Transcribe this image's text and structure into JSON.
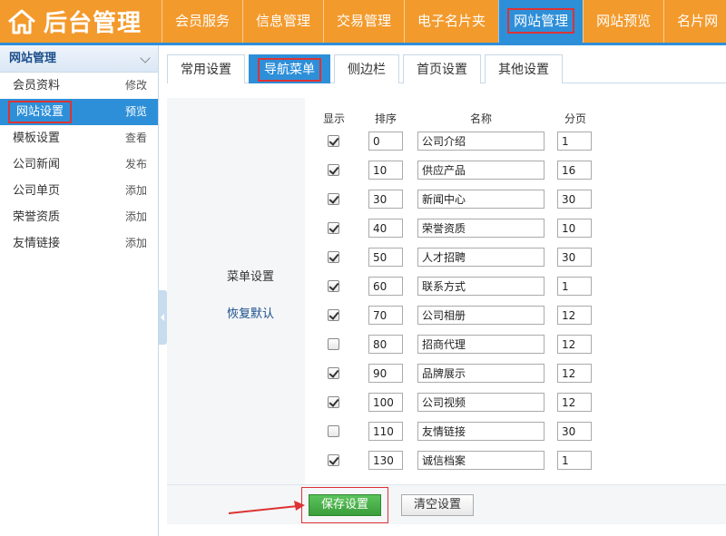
{
  "brand": {
    "title": "后台管理",
    "icon": "home-icon"
  },
  "top_nav": [
    {
      "label": "会员服务",
      "active": false
    },
    {
      "label": "信息管理",
      "active": false
    },
    {
      "label": "交易管理",
      "active": false
    },
    {
      "label": "电子名片夹",
      "active": false
    },
    {
      "label": "网站管理",
      "active": true
    },
    {
      "label": "网站预览",
      "active": false
    },
    {
      "label": "名片网",
      "active": false
    }
  ],
  "sidebar": {
    "heading": "网站管理",
    "items": [
      {
        "label": "会员资料",
        "action": "修改",
        "active": false
      },
      {
        "label": "网站设置",
        "action": "预览",
        "active": true
      },
      {
        "label": "模板设置",
        "action": "查看",
        "active": false
      },
      {
        "label": "公司新闻",
        "action": "发布",
        "active": false
      },
      {
        "label": "公司单页",
        "action": "添加",
        "active": false
      },
      {
        "label": "荣誉资质",
        "action": "添加",
        "active": false
      },
      {
        "label": "友情链接",
        "action": "添加",
        "active": false
      }
    ]
  },
  "tabs": [
    {
      "label": "常用设置",
      "active": false
    },
    {
      "label": "导航菜单",
      "active": true
    },
    {
      "label": "侧边栏",
      "active": false
    },
    {
      "label": "首页设置",
      "active": false
    },
    {
      "label": "其他设置",
      "active": false
    }
  ],
  "section": {
    "label": "菜单设置",
    "reset_link": "恢复默认"
  },
  "table": {
    "headers": {
      "show": "显示",
      "order": "排序",
      "name": "名称",
      "page": "分页"
    },
    "rows": [
      {
        "show": true,
        "order": "0",
        "name": "公司介绍",
        "page": "1"
      },
      {
        "show": true,
        "order": "10",
        "name": "供应产品",
        "page": "16"
      },
      {
        "show": true,
        "order": "30",
        "name": "新闻中心",
        "page": "30"
      },
      {
        "show": true,
        "order": "40",
        "name": "荣誉资质",
        "page": "10"
      },
      {
        "show": true,
        "order": "50",
        "name": "人才招聘",
        "page": "30"
      },
      {
        "show": true,
        "order": "60",
        "name": "联系方式",
        "page": "1"
      },
      {
        "show": true,
        "order": "70",
        "name": "公司相册",
        "page": "12"
      },
      {
        "show": false,
        "order": "80",
        "name": "招商代理",
        "page": "12"
      },
      {
        "show": true,
        "order": "90",
        "name": "品牌展示",
        "page": "12"
      },
      {
        "show": true,
        "order": "100",
        "name": "公司视频",
        "page": "12"
      },
      {
        "show": false,
        "order": "110",
        "name": "友情链接",
        "page": "30"
      },
      {
        "show": true,
        "order": "130",
        "name": "诚信档案",
        "page": "1"
      }
    ]
  },
  "buttons": {
    "save": "保存设置",
    "clear": "清空设置"
  },
  "colors": {
    "brand_orange": "#f39a2c",
    "accent_blue": "#2e8fd9",
    "highlight_red": "#d33333",
    "save_green": "#3a9e3a"
  }
}
